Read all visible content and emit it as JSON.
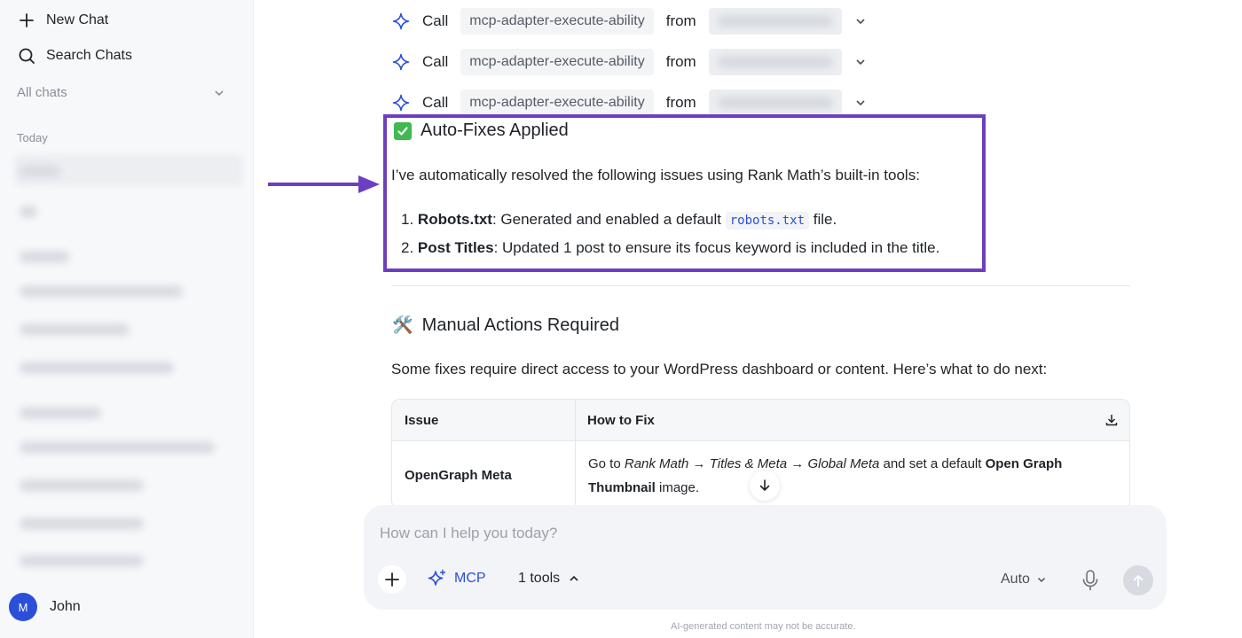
{
  "sidebar": {
    "new_chat": "New Chat",
    "search_chats": "Search Chats",
    "all_chats": "All chats",
    "today_label": "Today",
    "user": {
      "avatar_initial": "M",
      "name": "John"
    }
  },
  "calls": [
    {
      "verb": "Call",
      "tool": "mcp-adapter-execute-ability",
      "from": "from"
    },
    {
      "verb": "Call",
      "tool": "mcp-adapter-execute-ability",
      "from": "from"
    },
    {
      "verb": "Call",
      "tool": "mcp-adapter-execute-ability",
      "from": "from"
    }
  ],
  "autofix": {
    "title": "Auto-Fixes Applied",
    "intro": "I’ve automatically resolved the following issues using Rank Math’s built-in tools:",
    "items": [
      {
        "num": "1.",
        "label": "Robots.txt",
        "text_before": ": Generated and enabled a default ",
        "code": "robots.txt",
        "text_after": " file."
      },
      {
        "num": "2.",
        "label": "Post Titles",
        "text": ": Updated 1 post to ensure its focus keyword is included in the title."
      }
    ]
  },
  "manual": {
    "emoji": "🛠️",
    "title": "Manual Actions Required",
    "intro": "Some fixes require direct access to your WordPress dashboard or content. Here’s what to do next:",
    "table": {
      "headers": [
        "Issue",
        "How to Fix"
      ],
      "rows": [
        {
          "issue": "OpenGraph Meta",
          "fix_1": "Go to ",
          "fix_path": "Rank Math → Titles & Meta → Global Meta",
          "fix_2": " and set a default ",
          "fix_bold": "Open Graph Thumbnail",
          "fix_3": " image."
        }
      ]
    }
  },
  "composer": {
    "placeholder": "How can I help you today?",
    "mcp_label": "MCP",
    "tools_label": "1 tools",
    "model_label": "Auto",
    "disclaimer": "AI-generated content may not be accurate."
  },
  "colors": {
    "accent": "#2b4fd8",
    "highlight_border": "#6d3fc0",
    "check_green": "#3fb950"
  }
}
